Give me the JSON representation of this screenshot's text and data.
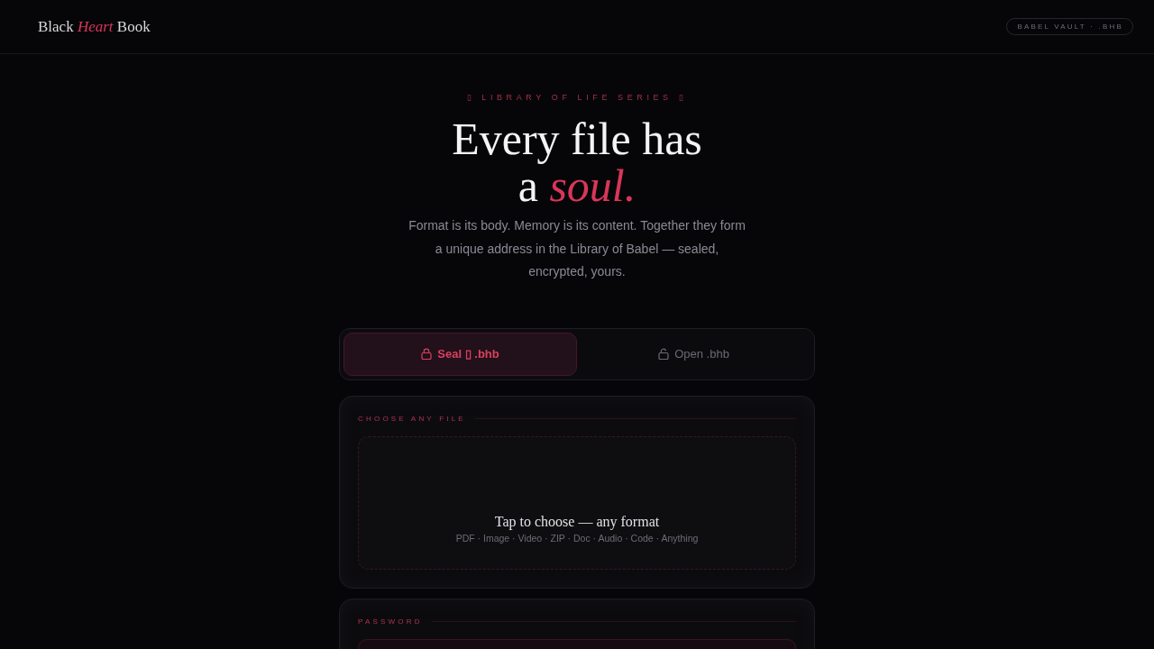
{
  "header": {
    "logo": "Black *Heart* Book",
    "badge": "BABEL VAULT · .BHB"
  },
  "hero": {
    "eyebrow": "▯ LIBRARY OF LIFE SERIES ▯",
    "title_line_1": "Every file has",
    "title_line_2": "a *soul.*",
    "subtitle": "Format is its body. Memory is its content. Together they form a unique address in the Library of Babel — sealed, encrypted, yours."
  },
  "mode_tabs": [
    {
      "label": "Seal ▯ .bhb",
      "kind": "seal",
      "selected": true
    },
    {
      "label": "Open .bhb",
      "kind": "open",
      "selected": false
    }
  ],
  "sections": [
    {
      "kind": "dropzone",
      "label": "CHOOSE ANY FILE",
      "title": "Tap to choose — any format",
      "hint": "PDF · Image · Video · ZIP · Doc · Audio · Code · Anything"
    },
    {
      "kind": "password",
      "label": "PASSWORD"
    }
  ]
}
